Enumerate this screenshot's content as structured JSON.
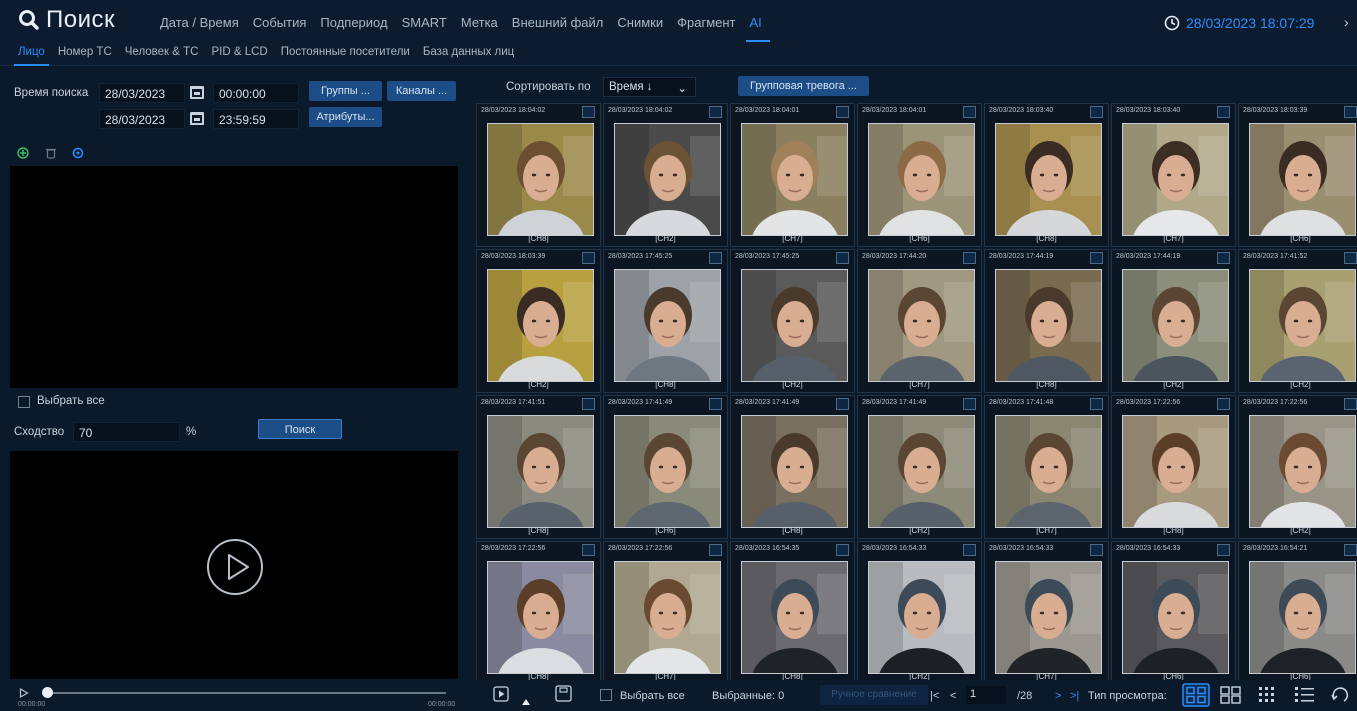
{
  "app": {
    "title": "Поиск"
  },
  "nav": {
    "items": [
      {
        "label": "Дата / Время",
        "active": false
      },
      {
        "label": "События",
        "active": false
      },
      {
        "label": "Подпериод",
        "active": false
      },
      {
        "label": "SMART",
        "active": false
      },
      {
        "label": "Метка",
        "active": false
      },
      {
        "label": "Внешний файл",
        "active": false
      },
      {
        "label": "Снимки",
        "active": false
      },
      {
        "label": "Фрагмент",
        "active": false
      },
      {
        "label": "AI",
        "active": true
      }
    ],
    "clock": "28/03/2023 18:07:29"
  },
  "subtabs": [
    {
      "label": "Лицо",
      "active": true
    },
    {
      "label": "Номер ТС",
      "active": false
    },
    {
      "label": "Человек & ТС",
      "active": false
    },
    {
      "label": "PID & LCD",
      "active": false
    },
    {
      "label": "Постоянные посетители",
      "active": false
    },
    {
      "label": "База данных лиц",
      "active": false
    }
  ],
  "search": {
    "time_label": "Время поиска",
    "start_date": "28/03/2023",
    "start_time": "00:00:00",
    "end_date": "28/03/2023",
    "end_time": "23:59:59",
    "groups_button": "Группы ...",
    "channels_button": "Каналы ...",
    "attributes_button": "Атрибуты...",
    "select_all": "Выбрать все",
    "similarity_label": "Сходство",
    "similarity_value": "70",
    "percent": "%",
    "search_button": "Поиск"
  },
  "player": {
    "time_start": "00:00:00",
    "time_end": "00:00:00"
  },
  "results": {
    "sort_label": "Сортировать по",
    "sort_value": "Время ↓",
    "group_alarm_button": "Групповая тревога ...",
    "items": [
      {
        "ts": "28/03/2023 18:04:02",
        "ch": "[CH8]",
        "shirt": "#cfd3d8",
        "hair": "#6b4f30",
        "bg": "#9a8a4a"
      },
      {
        "ts": "28/03/2023 18:04:02",
        "ch": "[CH2]",
        "shirt": "#d8d9dc",
        "hair": "#6b5235",
        "bg": "#4a4a4a"
      },
      {
        "ts": "28/03/2023 18:04:01",
        "ch": "[CH7]",
        "shirt": "#e3e4e6",
        "hair": "#a08058",
        "bg": "#8a8060"
      },
      {
        "ts": "28/03/2023 18:04:01",
        "ch": "[CH6]",
        "shirt": "#e0e1e3",
        "hair": "#8c6a45",
        "bg": "#9c9478"
      },
      {
        "ts": "28/03/2023 18:03:40",
        "ch": "[CH8]",
        "shirt": "#d6d7d9",
        "hair": "#3a2c22",
        "bg": "#a89050"
      },
      {
        "ts": "28/03/2023 18:03:40",
        "ch": "[CH7]",
        "shirt": "#e6e7e9",
        "hair": "#3d2e24",
        "bg": "#b0a888"
      },
      {
        "ts": "28/03/2023 18:03:39",
        "ch": "[CH6]",
        "shirt": "#dfe0e2",
        "hair": "#3a2c22",
        "bg": "#9a8e70"
      },
      {
        "ts": "28/03/2023 18:03:39",
        "ch": "[CH2]",
        "shirt": "#d9dadc",
        "hair": "#3a2c22",
        "bg": "#b8a040"
      },
      {
        "ts": "28/03/2023 17:45:25",
        "ch": "[CH8]",
        "shirt": "#6f7780",
        "hair": "#4a3a2c",
        "bg": "#9ca2a8"
      },
      {
        "ts": "28/03/2023 17:45:25",
        "ch": "[CH2]",
        "shirt": "#55606a",
        "hair": "#4a3a2c",
        "bg": "#5a5a5a"
      },
      {
        "ts": "28/03/2023 17:44:20",
        "ch": "[CH7]",
        "shirt": "#5b646d",
        "hair": "#5a4632",
        "bg": "#a09880"
      },
      {
        "ts": "28/03/2023 17:44:19",
        "ch": "[CH8]",
        "shirt": "#4f5862",
        "hair": "#4a3a2c",
        "bg": "#7a6a50"
      },
      {
        "ts": "28/03/2023 17:44:19",
        "ch": "[CH2]",
        "shirt": "#4c545d",
        "hair": "#5a4632",
        "bg": "#8a8e7a"
      },
      {
        "ts": "28/03/2023 17:41:52",
        "ch": "[CH2]",
        "shirt": "#5a6470",
        "hair": "#5a4632",
        "bg": "#a8a070"
      },
      {
        "ts": "28/03/2023 17:41:51",
        "ch": "[CH8]",
        "shirt": "#59626c",
        "hair": "#5a4632",
        "bg": "#8a8a80"
      },
      {
        "ts": "28/03/2023 17:41:49",
        "ch": "[CH6]",
        "shirt": "#5e6770",
        "hair": "#5a4632",
        "bg": "#8a8a7a"
      },
      {
        "ts": "28/03/2023 17:41:49",
        "ch": "[CH8]",
        "shirt": "#57606a",
        "hair": "#4a3a2c",
        "bg": "#7a7060"
      },
      {
        "ts": "28/03/2023 17:41:49",
        "ch": "[CH2]",
        "shirt": "#58616b",
        "hair": "#5a4632",
        "bg": "#8c8a78"
      },
      {
        "ts": "28/03/2023 17:41:48",
        "ch": "[CH7]",
        "shirt": "#5c656e",
        "hair": "#5a4632",
        "bg": "#8a8672"
      },
      {
        "ts": "28/03/2023 17:22:56",
        "ch": "[CH8]",
        "shirt": "#d9dadc",
        "hair": "#5a3e28",
        "bg": "#a89a80"
      },
      {
        "ts": "28/03/2023 17:22:56",
        "ch": "[CH2]",
        "shirt": "#e2e3e5",
        "hair": "#6a4a30",
        "bg": "#9a9488"
      },
      {
        "ts": "28/03/2023 17:22:56",
        "ch": "[CH8]",
        "shirt": "#dcdde0",
        "hair": "#5a3e28",
        "bg": "#8a8aa0"
      },
      {
        "ts": "28/03/2023 17:22:56",
        "ch": "[CH7]",
        "shirt": "#e4e5e7",
        "hair": "#6a4a30",
        "bg": "#b0a890"
      },
      {
        "ts": "28/03/2023 16:54:35",
        "ch": "[CH8]",
        "shirt": "#1e2328",
        "hair": "#3d4a58",
        "bg": "#6a6a70"
      },
      {
        "ts": "28/03/2023 16:54:33",
        "ch": "[CH2]",
        "shirt": "#1b2026",
        "hair": "#3d4a58",
        "bg": "#b8bcc0"
      },
      {
        "ts": "28/03/2023 16:54:33",
        "ch": "[CH7]",
        "shirt": "#202328",
        "hair": "#3d4a58",
        "bg": "#9a9890"
      },
      {
        "ts": "28/03/2023 16:54:33",
        "ch": "[CH6]",
        "shirt": "#1d2126",
        "hair": "#3d4a58",
        "bg": "#5a5a5e"
      },
      {
        "ts": "28/03/2023 16:54:21",
        "ch": "[CH6]",
        "shirt": "#1e2227",
        "hair": "#3d4a58",
        "bg": "#8a8a88"
      }
    ]
  },
  "footer": {
    "select_all": "Выбрать все",
    "selected": "Выбранные: 0",
    "manual_compare": "Ручное сравнение",
    "page_current": "1",
    "page_total": "/28",
    "view_type": "Тип просмотра:"
  },
  "colors": {
    "accent": "#2b8cff",
    "panel": "#0b1a2b",
    "button": "#1c4d86"
  }
}
